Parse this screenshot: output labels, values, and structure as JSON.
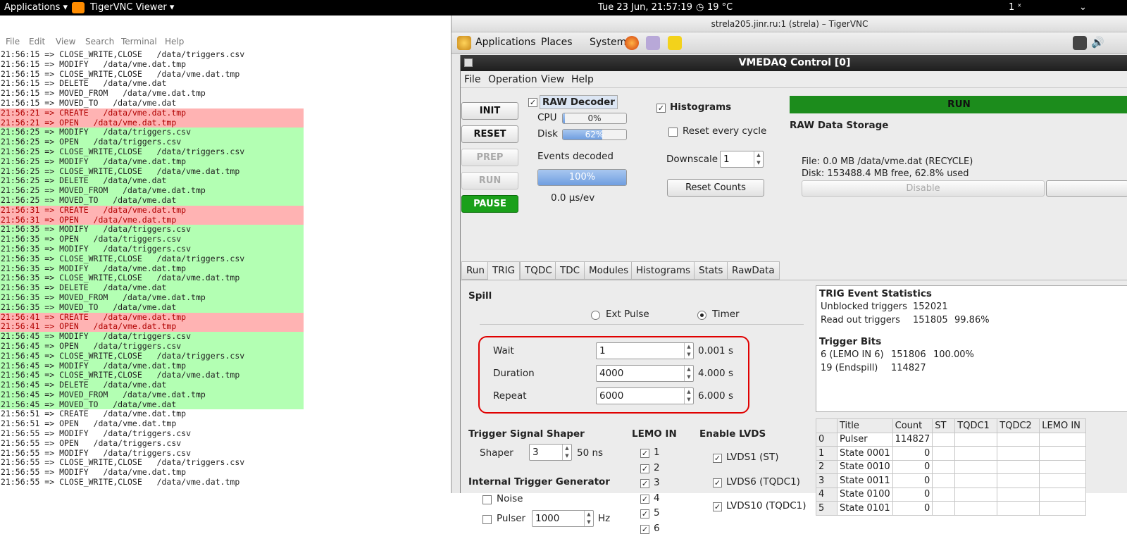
{
  "topbar": {
    "applications": "Applications ▾",
    "app_name": "TigerVNC Viewer ▾",
    "datetime": "Tue 23 Jun, 21:57:19",
    "weather": "19 °C",
    "right_indicator": "1 ˣ"
  },
  "terminal": {
    "menu": [
      "File",
      "Edit",
      "View",
      "Search",
      "Terminal",
      "Help"
    ],
    "lines": [
      {
        "t": "21:56:15 => CLOSE_WRITE,CLOSE   /data/triggers.csv",
        "c": ""
      },
      {
        "t": "21:56:15 => MODIFY   /data/vme.dat.tmp",
        "c": ""
      },
      {
        "t": "21:56:15 => CLOSE_WRITE,CLOSE   /data/vme.dat.tmp",
        "c": ""
      },
      {
        "t": "21:56:15 => DELETE   /data/vme.dat",
        "c": ""
      },
      {
        "t": "21:56:15 => MOVED_FROM   /data/vme.dat.tmp",
        "c": ""
      },
      {
        "t": "21:56:15 => MOVED_TO   /data/vme.dat",
        "c": ""
      },
      {
        "t": "21:56:21 => CREATE   /data/vme.dat.tmp",
        "c": "red"
      },
      {
        "t": "21:56:21 => OPEN   /data/vme.dat.tmp",
        "c": "red"
      },
      {
        "t": "21:56:25 => MODIFY   /data/triggers.csv",
        "c": "green"
      },
      {
        "t": "21:56:25 => OPEN   /data/triggers.csv",
        "c": "green"
      },
      {
        "t": "21:56:25 => CLOSE_WRITE,CLOSE   /data/triggers.csv",
        "c": "green"
      },
      {
        "t": "21:56:25 => MODIFY   /data/vme.dat.tmp",
        "c": "green"
      },
      {
        "t": "21:56:25 => CLOSE_WRITE,CLOSE   /data/vme.dat.tmp",
        "c": "green"
      },
      {
        "t": "21:56:25 => DELETE   /data/vme.dat",
        "c": "green"
      },
      {
        "t": "21:56:25 => MOVED_FROM   /data/vme.dat.tmp",
        "c": "green"
      },
      {
        "t": "21:56:25 => MOVED_TO   /data/vme.dat",
        "c": "green"
      },
      {
        "t": "21:56:31 => CREATE   /data/vme.dat.tmp",
        "c": "red"
      },
      {
        "t": "21:56:31 => OPEN   /data/vme.dat.tmp",
        "c": "red"
      },
      {
        "t": "21:56:35 => MODIFY   /data/triggers.csv",
        "c": "green"
      },
      {
        "t": "21:56:35 => OPEN   /data/triggers.csv",
        "c": "green"
      },
      {
        "t": "21:56:35 => MODIFY   /data/triggers.csv",
        "c": "green"
      },
      {
        "t": "21:56:35 => CLOSE_WRITE,CLOSE   /data/triggers.csv",
        "c": "green"
      },
      {
        "t": "21:56:35 => MODIFY   /data/vme.dat.tmp",
        "c": "green"
      },
      {
        "t": "21:56:35 => CLOSE_WRITE,CLOSE   /data/vme.dat.tmp",
        "c": "green"
      },
      {
        "t": "21:56:35 => DELETE   /data/vme.dat",
        "c": "green"
      },
      {
        "t": "21:56:35 => MOVED_FROM   /data/vme.dat.tmp",
        "c": "green"
      },
      {
        "t": "21:56:35 => MOVED_TO   /data/vme.dat",
        "c": "green"
      },
      {
        "t": "21:56:41 => CREATE   /data/vme.dat.tmp",
        "c": "red"
      },
      {
        "t": "21:56:41 => OPEN   /data/vme.dat.tmp",
        "c": "red"
      },
      {
        "t": "21:56:45 => MODIFY   /data/triggers.csv",
        "c": "green"
      },
      {
        "t": "21:56:45 => OPEN   /data/triggers.csv",
        "c": "green"
      },
      {
        "t": "21:56:45 => CLOSE_WRITE,CLOSE   /data/triggers.csv",
        "c": "green"
      },
      {
        "t": "21:56:45 => MODIFY   /data/vme.dat.tmp",
        "c": "green"
      },
      {
        "t": "21:56:45 => CLOSE_WRITE,CLOSE   /data/vme.dat.tmp",
        "c": "green"
      },
      {
        "t": "21:56:45 => DELETE   /data/vme.dat",
        "c": "green"
      },
      {
        "t": "21:56:45 => MOVED_FROM   /data/vme.dat.tmp",
        "c": "green"
      },
      {
        "t": "21:56:45 => MOVED_TO   /data/vme.dat",
        "c": "green"
      },
      {
        "t": "21:56:51 => CREATE   /data/vme.dat.tmp",
        "c": ""
      },
      {
        "t": "21:56:51 => OPEN   /data/vme.dat.tmp",
        "c": ""
      },
      {
        "t": "21:56:55 => MODIFY   /data/triggers.csv",
        "c": ""
      },
      {
        "t": "21:56:55 => OPEN   /data/triggers.csv",
        "c": ""
      },
      {
        "t": "21:56:55 => MODIFY   /data/triggers.csv",
        "c": ""
      },
      {
        "t": "21:56:55 => CLOSE_WRITE,CLOSE   /data/triggers.csv",
        "c": ""
      },
      {
        "t": "21:56:55 => MODIFY   /data/vme.dat.tmp",
        "c": ""
      },
      {
        "t": "21:56:55 => CLOSE_WRITE,CLOSE   /data/vme.dat.tmp",
        "c": ""
      }
    ]
  },
  "vnc": {
    "title": "strela205.jinr.ru:1 (strela) – TigerVNC",
    "panel": {
      "applications": "Applications",
      "places": "Places",
      "system": "System"
    }
  },
  "vme": {
    "title": "VMEDAQ Control [0]",
    "menu": [
      "File",
      "Operation",
      "View",
      "Help"
    ],
    "buttons": {
      "init": "INIT",
      "reset": "RESET",
      "prep": "PREP",
      "run": "RUN",
      "pause": "PAUSE"
    },
    "raw_decoder": "RAW Decoder",
    "cpu_label": "CPU",
    "cpu_value": "0%",
    "cpu_fraction": 0.03,
    "disk_label": "Disk",
    "disk_value": "62%",
    "disk_fraction": 0.62,
    "events_label": "Events decoded",
    "events_value": "100%",
    "events_fraction": 1.0,
    "rate": "0.0 μs/ev",
    "histograms": "Histograms",
    "reset_every_cycle": "Reset every cycle",
    "downscale_label": "Downscale",
    "downscale_value": "1",
    "reset_counts": "Reset Counts",
    "run_status": "RUN",
    "raw_storage": "RAW Data Storage",
    "file_info": "File: 0.0 MB /data/vme.dat  (RECYCLE)",
    "disk_info": "Disk: 153488.4 MB free, 62.8% used",
    "disable": "Disable",
    "tabs": [
      "Run",
      "TRIG",
      "TQDC",
      "TDC",
      "Modules",
      "Histograms",
      "Stats",
      "RawData"
    ],
    "spill": {
      "title": "Spill",
      "ext_pulse": "Ext Pulse",
      "timer": "Timer",
      "rows": [
        {
          "label": "Wait",
          "value": "1",
          "unit": "0.001 s"
        },
        {
          "label": "Duration",
          "value": "4000",
          "unit": "4.000 s"
        },
        {
          "label": "Repeat",
          "value": "6000",
          "unit": "6.000 s"
        }
      ]
    },
    "shaper": {
      "title": "Trigger Signal Shaper",
      "label": "Shaper",
      "value": "3",
      "unit": "50 ns"
    },
    "internal": {
      "title": "Internal Trigger Generator",
      "noise": "Noise",
      "pulser": "Pulser",
      "pulser_value": "1000",
      "pulser_unit": "Hz"
    },
    "lemo_in": {
      "title": "LEMO IN",
      "items": [
        "1",
        "2",
        "3",
        "4",
        "5",
        "6"
      ]
    },
    "lvds": {
      "title": "Enable LVDS",
      "items": [
        "LVDS1 (ST)",
        "LVDS6 (TQDC1)",
        "LVDS10 (TQDC1)"
      ]
    },
    "stats": {
      "title": "TRIG Event Statistics",
      "unblocked_label": "Unblocked triggers",
      "unblocked_value": "152021",
      "readout_label": "Read out triggers",
      "readout_value": "151805",
      "readout_pct": "99.86%",
      "bits_title": "Trigger Bits",
      "bit1_label": "6 (LEMO IN 6)",
      "bit1_value": "151806",
      "bit1_pct": "100.00%",
      "bit2_label": "19 (Endspill)",
      "bit2_value": "114827"
    },
    "table": {
      "headers": [
        "",
        "Title",
        "Count",
        "ST",
        "TQDC1",
        "TQDC2",
        "LEMO IN"
      ],
      "rows": [
        [
          "0",
          "Pulser",
          "114827"
        ],
        [
          "1",
          "State 0001",
          "0"
        ],
        [
          "2",
          "State 0010",
          "0"
        ],
        [
          "3",
          "State 0011",
          "0"
        ],
        [
          "4",
          "State 0100",
          "0"
        ],
        [
          "5",
          "State 0101",
          "0"
        ]
      ]
    }
  },
  "colors": {
    "run_green": "#1aa01a",
    "red_highlight": "#ffb3b3",
    "green_highlight": "#b3ffb3",
    "box_red": "#e00000"
  }
}
